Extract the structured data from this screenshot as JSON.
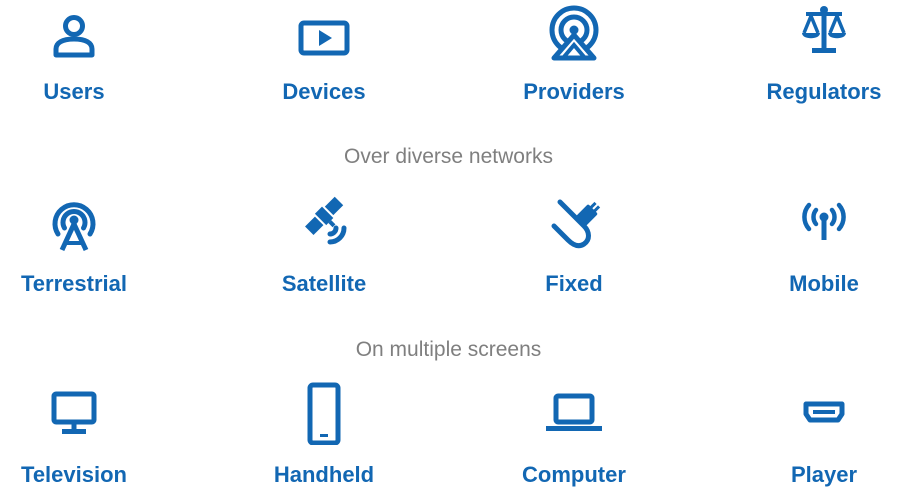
{
  "rows": [
    {
      "items": [
        {
          "label": "Users",
          "icon": "user-icon"
        },
        {
          "label": "Devices",
          "icon": "play-icon"
        },
        {
          "label": "Providers",
          "icon": "broadcast-tower-icon"
        },
        {
          "label": "Regulators",
          "icon": "scales-icon"
        }
      ]
    },
    {
      "separator": "Over diverse networks",
      "items": [
        {
          "label": "Terrestrial",
          "icon": "antenna-tower-icon"
        },
        {
          "label": "Satellite",
          "icon": "satellite-icon"
        },
        {
          "label": "Fixed",
          "icon": "cable-icon"
        },
        {
          "label": "Mobile",
          "icon": "mobile-signal-icon"
        }
      ]
    },
    {
      "separator": "On multiple screens",
      "items": [
        {
          "label": "Television",
          "icon": "monitor-icon"
        },
        {
          "label": "Handheld",
          "icon": "smartphone-icon"
        },
        {
          "label": "Computer",
          "icon": "laptop-icon"
        },
        {
          "label": "Player",
          "icon": "hdmi-port-icon"
        }
      ]
    }
  ],
  "colors": {
    "accent": "#1267b3",
    "separator_text": "#7f7f7f",
    "background": "#ffffff"
  }
}
